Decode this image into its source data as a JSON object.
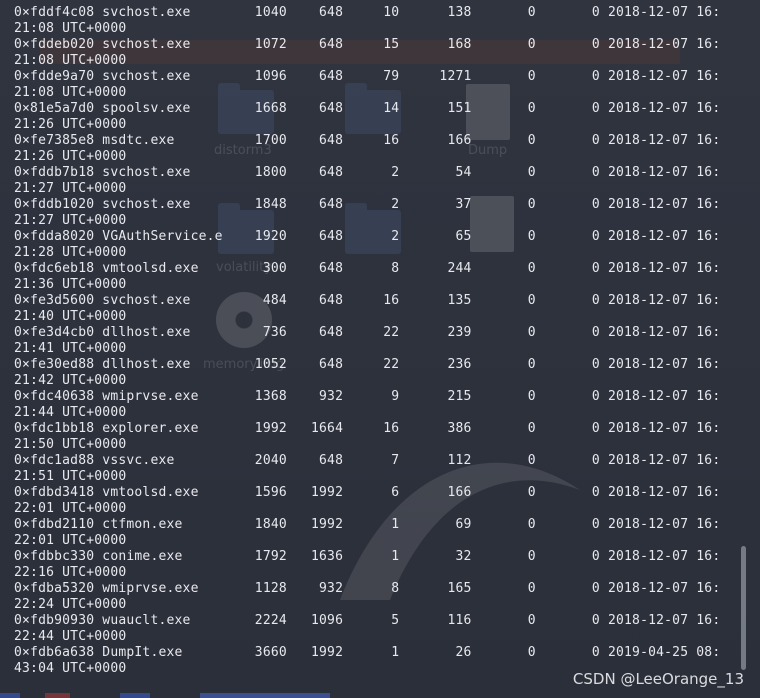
{
  "terminal": {
    "lines": [
      "0×fddf4c08 svchost.exe        1040    648     10      138       0       0 2018-12-07 16:",
      "21:08 UTC+0000",
      "0×fddeb020 svchost.exe        1072    648     15      168       0       0 2018-12-07 16:",
      "21:08 UTC+0000",
      "0×fdde9a70 svchost.exe        1096    648     79     1271       0       0 2018-12-07 16:",
      "21:08 UTC+0000",
      "0×81e5a7d0 spoolsv.exe        1668    648     14      151       0       0 2018-12-07 16:",
      "21:26 UTC+0000",
      "0×fe7385e8 msdtc.exe          1700    648     16      166       0       0 2018-12-07 16:",
      "21:26 UTC+0000",
      "0×fddb7b18 svchost.exe        1800    648      2       54       0       0 2018-12-07 16:",
      "21:27 UTC+0000",
      "0×fddb1020 svchost.exe        1848    648      2       37       0       0 2018-12-07 16:",
      "21:27 UTC+0000",
      "0×fdda8020 VGAuthService.e    1920    648      2       65       0       0 2018-12-07 16:",
      "21:28 UTC+0000",
      "0×fdc6eb18 vmtoolsd.exe        300    648      8      244       0       0 2018-12-07 16:",
      "21:36 UTC+0000",
      "0×fe3d5600 svchost.exe         484    648     16      135       0       0 2018-12-07 16:",
      "21:40 UTC+0000",
      "0×fe3d4cb0 dllhost.exe         736    648     22      239       0       0 2018-12-07 16:",
      "21:41 UTC+0000",
      "0×fe30ed88 dllhost.exe        1052    648     22      236       0       0 2018-12-07 16:",
      "21:42 UTC+0000",
      "0×fdc40638 wmiprvse.exe       1368    932      9      215       0       0 2018-12-07 16:",
      "21:44 UTC+0000",
      "0×fdc1bb18 explorer.exe       1992   1664     16      386       0       0 2018-12-07 16:",
      "21:50 UTC+0000",
      "0×fdc1ad88 vssvc.exe          2040    648      7      112       0       0 2018-12-07 16:",
      "21:51 UTC+0000",
      "0×fdbd3418 vmtoolsd.exe       1596   1992      6      166       0       0 2018-12-07 16:",
      "22:01 UTC+0000",
      "0×fdbd2110 ctfmon.exe         1840   1992      1       69       0       0 2018-12-07 16:",
      "22:01 UTC+0000",
      "0×fdbbc330 conime.exe         1792   1636      1       32       0       0 2018-12-07 16:",
      "22:16 UTC+0000",
      "0×fdba5320 wmiprvse.exe       1128    932      8      165       0       0 2018-12-07 16:",
      "22:24 UTC+0000",
      "0×fdb90930 wuauclt.exe        2224   1096      5      116       0       0 2018-12-07 16:",
      "22:44 UTC+0000",
      "0×fdb6a638 DumpIt.exe         3660   1992      1       26       0       0 2019-04-25 08:",
      "43:04 UTC+0000"
    ]
  },
  "watermark": "CSDN @LeeOrange_13",
  "background_labels": [
    "distorm3",
    "volatility",
    "memory.img",
    "Dump"
  ],
  "colors": {
    "background": "#2d313c",
    "text": "#e8e9ee",
    "scrollbar": "#8e939e"
  }
}
